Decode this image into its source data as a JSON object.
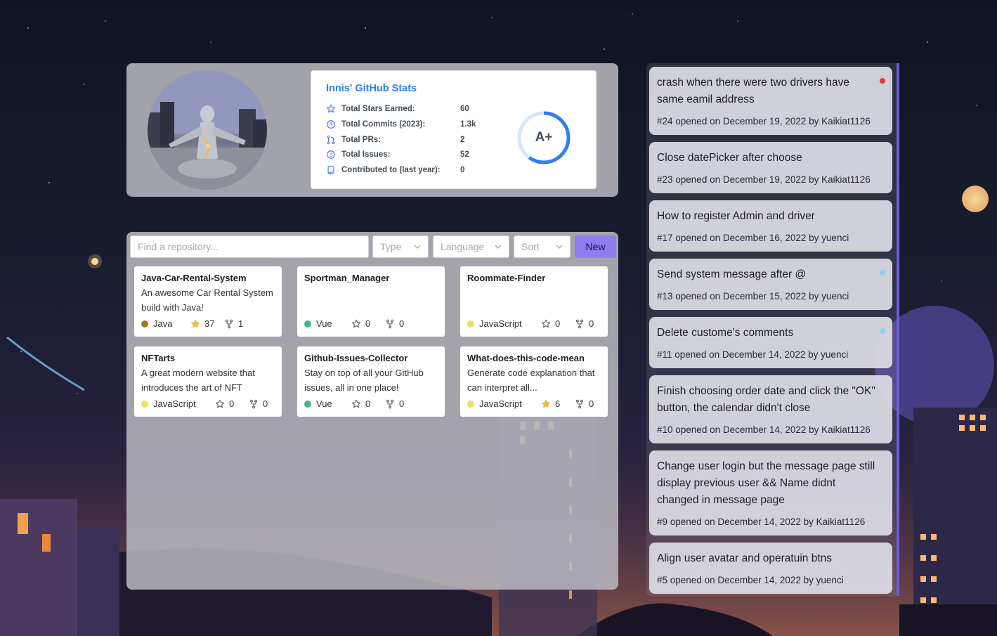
{
  "profile": {
    "stats_title": "Innis' GitHub Stats",
    "stats": [
      {
        "icon": "star-icon",
        "label": "Total Stars Earned:",
        "value": "60"
      },
      {
        "icon": "history-icon",
        "label": "Total Commits (2023):",
        "value": "1.3k"
      },
      {
        "icon": "pull-request-icon",
        "label": "Total PRs:",
        "value": "2"
      },
      {
        "icon": "issue-icon",
        "label": "Total Issues:",
        "value": "52"
      },
      {
        "icon": "repo-icon",
        "label": "Contributed to (last year):",
        "value": "0"
      }
    ],
    "rank": "A+",
    "rank_progress": 0.6,
    "accent_color": "#2f80ed"
  },
  "repos": {
    "search_placeholder": "Find a repository...",
    "filters": [
      {
        "label": "Type"
      },
      {
        "label": "Language"
      },
      {
        "label": "Sort"
      }
    ],
    "new_label": "New",
    "new_color": "#8f7cf0",
    "items": [
      {
        "name": "Java-Car-Rental-System",
        "description": "An awesome Car Rental System build with Java!",
        "language": "Java",
        "language_color": "#b07219",
        "stars": "37",
        "forks": "1",
        "starred": true
      },
      {
        "name": "Sportman_Manager",
        "description": "",
        "language": "Vue",
        "language_color": "#41b883",
        "stars": "0",
        "forks": "0",
        "starred": false
      },
      {
        "name": "Roommate-Finder",
        "description": "",
        "language": "JavaScript",
        "language_color": "#f1e05a",
        "stars": "0",
        "forks": "0",
        "starred": false
      },
      {
        "name": "NFTarts",
        "description": "A great modern website that introduces the art of NFT",
        "language": "JavaScript",
        "language_color": "#f1e05a",
        "stars": "0",
        "forks": "0",
        "starred": false
      },
      {
        "name": "Github-Issues-Collector",
        "description": "Stay on top of all your GitHub issues, all in one place!",
        "language": "Vue",
        "language_color": "#41b883",
        "stars": "0",
        "forks": "0",
        "starred": false
      },
      {
        "name": "What-does-this-code-mean",
        "description": "Generate code explanation that can interpret all...",
        "language": "JavaScript",
        "language_color": "#f1e05a",
        "stars": "6",
        "forks": "0",
        "starred": true
      }
    ]
  },
  "issues": [
    {
      "title": "crash when there were two drivers have same eamil address",
      "meta": "#24 opened on December 19, 2022 by Kaikiat1126",
      "dot_color": "#e0393e"
    },
    {
      "title": "Close datePicker after choose",
      "meta": "#23 opened on December 19, 2022 by Kaikiat1126",
      "dot_color": ""
    },
    {
      "title": "How to register Admin and driver",
      "meta": "#17 opened on December 16, 2022 by yuenci",
      "dot_color": ""
    },
    {
      "title": "Send system message after @",
      "meta": "#13 opened on December 15, 2022 by yuenci",
      "dot_color": "#8fd3f4"
    },
    {
      "title": "Delete custome's comments",
      "meta": "#11 opened on December 14, 2022 by yuenci",
      "dot_color": "#8fd3f4"
    },
    {
      "title": "Finish choosing order date and click the \"OK\" button, the calendar didn't close",
      "meta": "#10 opened on December 14, 2022 by Kaikiat1126",
      "dot_color": ""
    },
    {
      "title": "Change user login but the message page still display previous user && Name didnt changed in message page",
      "meta": "#9 opened on December 14, 2022 by Kaikiat1126",
      "dot_color": ""
    },
    {
      "title": "Align user avatar and operatuin btns",
      "meta": "#5 opened on December 14, 2022 by yuenci",
      "dot_color": ""
    }
  ]
}
